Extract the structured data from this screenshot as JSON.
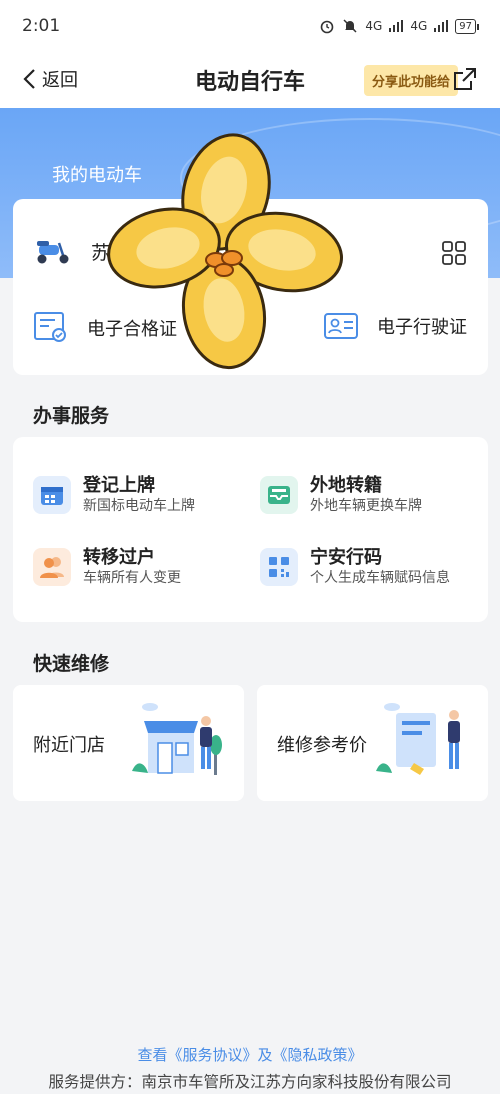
{
  "status_bar": {
    "time": "2:01",
    "signal_1": "4G",
    "signal_2": "4G",
    "battery": "97"
  },
  "nav": {
    "back_label": "返回",
    "title": "电动自行车",
    "share_label": "分享此功能给"
  },
  "hero": {
    "title": "我的电动车"
  },
  "vehicle": {
    "plate_prefix": "苏",
    "cert_1": "电子合格证",
    "cert_2": "电子行驶证"
  },
  "services": {
    "section_title": "办事服务",
    "items": [
      {
        "title": "登记上牌",
        "subtitle": "新国标电动车上牌",
        "icon": "calendar-icon",
        "color": "#4a8de6"
      },
      {
        "title": "外地转籍",
        "subtitle": "外地车辆更换车牌",
        "icon": "tray-icon",
        "color": "#39b38a"
      },
      {
        "title": "转移过户",
        "subtitle": "车辆所有人变更",
        "icon": "users-icon",
        "color": "#f0914a"
      },
      {
        "title": "宁安行码",
        "subtitle": "个人生成车辆赋码信息",
        "icon": "qrcode-icon",
        "color": "#4a8de6"
      }
    ]
  },
  "repair": {
    "section_title": "快速维修",
    "items": [
      {
        "label": "附近门店",
        "icon": "shop-illustration-icon"
      },
      {
        "label": "维修参考价",
        "icon": "repair-illustration-icon"
      }
    ]
  },
  "footer": {
    "links": "查看《服务协议》及《隐私政策》",
    "provider": "服务提供方：南京市车管所及江苏方向家科技股份有限公司"
  }
}
